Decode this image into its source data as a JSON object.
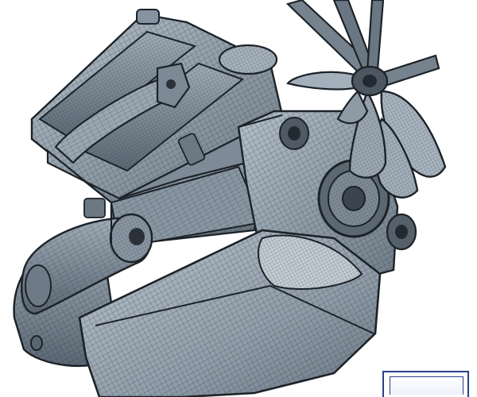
{
  "image": {
    "subject": "engine-wireframe-render",
    "background": "#ffffff",
    "mesh_fill": "#8795a1",
    "mesh_light": "#aab6c0",
    "mesh_shadow": "#4a5560",
    "wire_color": "#1c2228",
    "badge_color": "#2b3f8f"
  }
}
